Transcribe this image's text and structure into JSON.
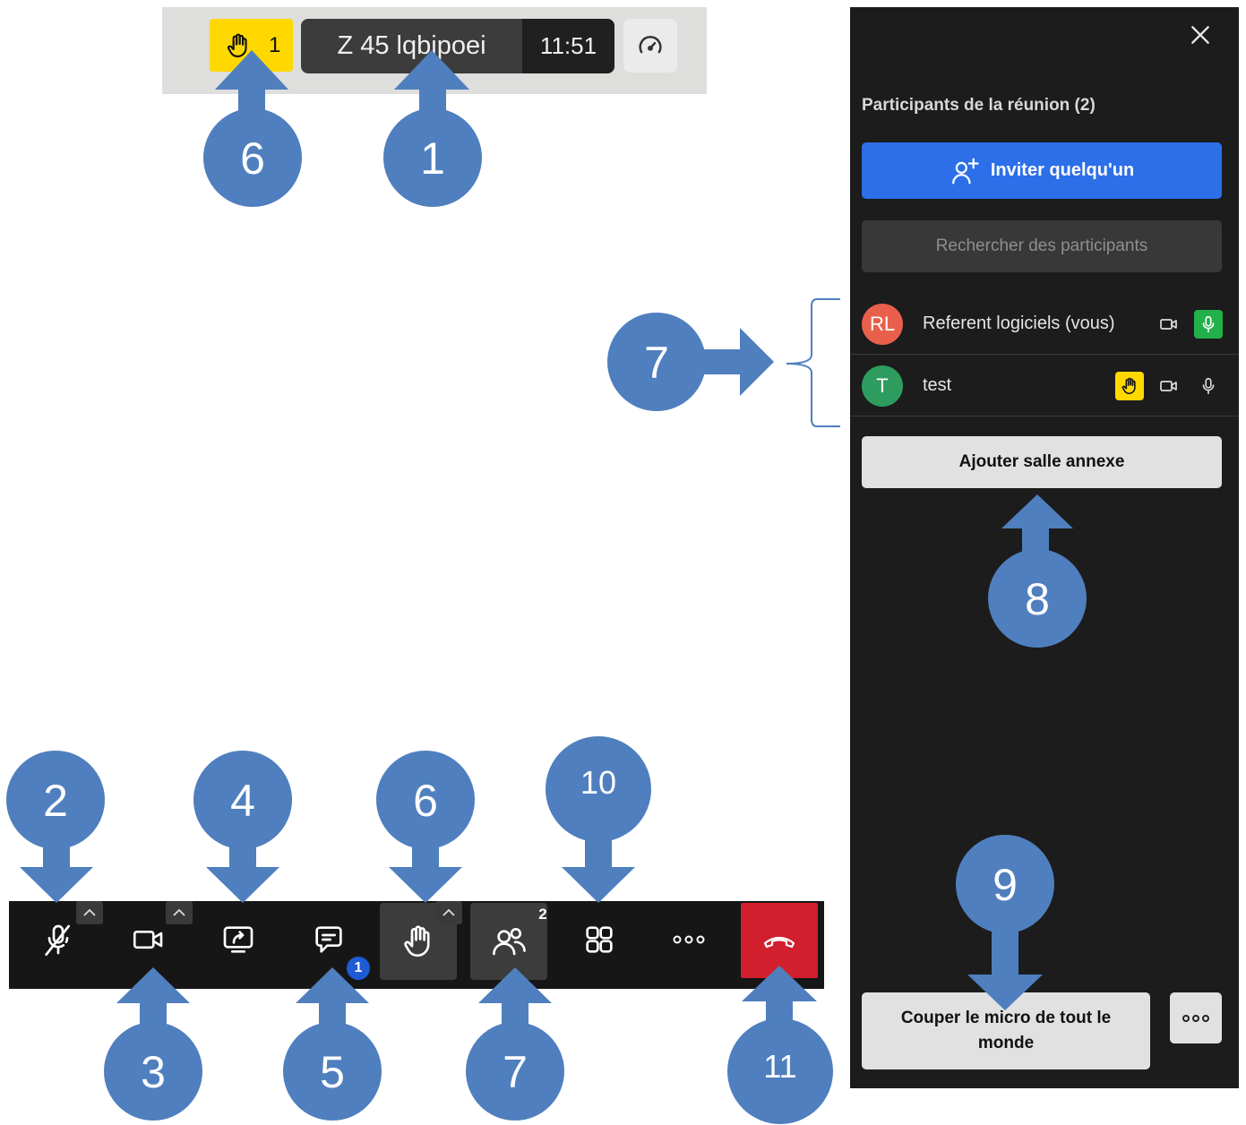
{
  "topbar": {
    "raised_hands_count": "1",
    "meeting_name": "Z 45 lqbipoei",
    "elapsed_time": "11:51",
    "icons": {
      "hand": "raised-hand-icon",
      "speed": "speedometer-icon"
    }
  },
  "panel": {
    "title": "Participants de la réunion (2)",
    "invite_label": "Inviter quelqu'un",
    "search_placeholder": "Rechercher des participants",
    "participants": [
      {
        "initials": "RL",
        "name": "Referent logiciels (vous)",
        "avatar_color": "#e8604c",
        "mic_active": true,
        "hand_raised": false
      },
      {
        "initials": "T",
        "name": "test",
        "avatar_color": "#2e9c5e",
        "mic_active": false,
        "hand_raised": true
      }
    ],
    "breakout_label": "Ajouter salle annexe",
    "mute_all_label": "Couper le micro de tout le monde"
  },
  "toolbar": {
    "chat_badge": "1",
    "participants_count": "2",
    "buttons": [
      "microphone",
      "camera",
      "share-screen",
      "chat",
      "raise-hand",
      "participants",
      "tile-view",
      "more",
      "leave"
    ]
  },
  "annotations": {
    "callout_1": "1",
    "callout_2": "2",
    "callout_3": "3",
    "callout_4": "4",
    "callout_5": "5",
    "callout_6_top": "6",
    "callout_6_toolbar": "6",
    "callout_7_panel": "7",
    "callout_7_toolbar": "7",
    "callout_8": "8",
    "callout_9": "9",
    "callout_10": "10",
    "callout_11": "11"
  },
  "colors": {
    "highlight_yellow": "#ffd800",
    "invite_blue": "#2c6fe8",
    "leave_red": "#d11f2d",
    "mic_green": "#22b04b",
    "callout_blue": "#4f7fbe"
  }
}
